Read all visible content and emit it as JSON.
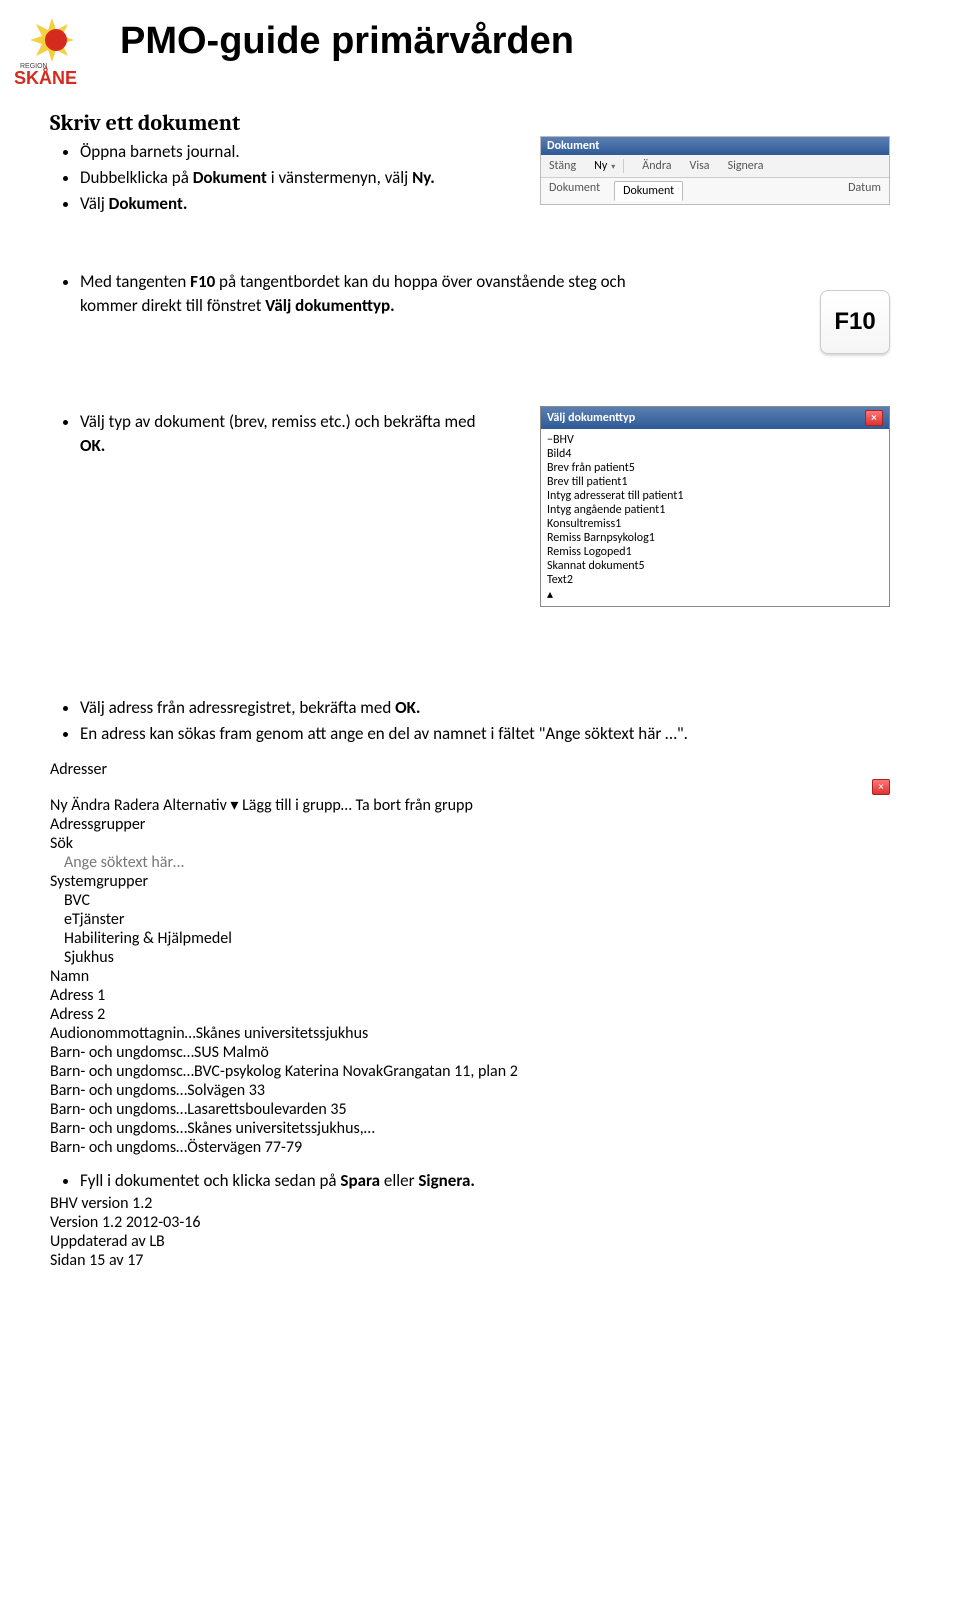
{
  "header": {
    "logo_text_top": "REGION",
    "logo_text_main": "SKÅNE",
    "title": "PMO-guide primärvården"
  },
  "section_title": "Skriv ett dokument",
  "block1": {
    "b1": "Öppna barnets journal.",
    "b2_pre": "Dubbelklicka på ",
    "b2_bold": "Dokument",
    "b2_post": " i vänstermenyn, välj ",
    "b2_bold2": "Ny.",
    "b3_pre": "Välj ",
    "b3_bold": "Dokument."
  },
  "toolbar": {
    "title": "Dokument",
    "stang": "Stäng",
    "ny": "Ny",
    "andra": "Ändra",
    "visa": "Visa",
    "signera": "Signera",
    "tab1": "Dokument",
    "tab2": "Dokument",
    "datum": "Datum"
  },
  "block2": {
    "b1_pre": "Med tangenten ",
    "b1_bold1": "F10",
    "b1_mid": " på tangentbordet kan du hoppa över ovanstående steg och kommer direkt till fönstret ",
    "b1_bold2": "Välj dokumenttyp.",
    "key_label": "F10"
  },
  "block3": {
    "b1_pre": "Välj typ av dokument (brev, remiss etc.) och bekräfta med ",
    "b1_bold": "OK."
  },
  "dokumenttyp": {
    "title": "Välj dokumenttyp",
    "root": "BHV",
    "rows": [
      {
        "label": "Bild",
        "n": "4"
      },
      {
        "label": "Brev från patient",
        "n": "5"
      },
      {
        "label": "Brev till patient",
        "n": "1"
      },
      {
        "label": "Intyg adresserat till patient",
        "n": "1"
      },
      {
        "label": "Intyg angående patient",
        "n": "1"
      },
      {
        "label": "Konsultremiss",
        "n": "1"
      },
      {
        "label": "Remiss Barnpsykolog",
        "n": "1"
      },
      {
        "label": "Remiss Logoped",
        "n": "1"
      },
      {
        "label": "Skannat dokument",
        "n": "5"
      },
      {
        "label": "Text",
        "n": "2"
      }
    ]
  },
  "block4": {
    "b1_pre": "Välj adress från adressregistret, bekräfta med ",
    "b1_bold": "OK.",
    "b2": "En adress kan sökas fram genom att ange en del av namnet i fältet \"Ange söktext här …\"."
  },
  "adresser": {
    "title": "Adresser",
    "tb": {
      "ny": "Ny",
      "andra": "Ändra",
      "radera": "Radera",
      "alternativ": "Alternativ",
      "lagg": "Lägg till i grupp…",
      "tabort": "Ta bort från grupp"
    },
    "left_hdr": "Adressgrupper",
    "left_items": {
      "sok": "Sök",
      "sok_hint": "Ange söktext här…",
      "systemgrupper": "Systemgrupper",
      "bvc": "BVC",
      "etjanster": "eTjänster",
      "hab": "Habilitering & Hjälpmedel",
      "sjukhus": "Sjukhus"
    },
    "right_hdr": {
      "namn": "Namn",
      "a1": "Adress 1",
      "a2": "Adress 2"
    },
    "rows": [
      {
        "n": "Audionommottagnin…",
        "a1": "Skånes universitetssjukhus",
        "a2": ""
      },
      {
        "n": "Barn- och ungdomsc…",
        "a1": "SUS Malmö",
        "a2": ""
      },
      {
        "n": "Barn- och ungdomsc…",
        "a1": "BVC-psykolog Katerina Novak",
        "a2": "Grangatan 11, plan 2"
      },
      {
        "n": "Barn- och ungdoms…",
        "a1": "Solvägen 33",
        "a2": ""
      },
      {
        "n": "Barn- och ungdoms…",
        "a1": "Lasarettsboulevarden 35",
        "a2": ""
      },
      {
        "n": "Barn- och ungdoms…",
        "a1": "Skånes universitetssjukhus,…",
        "a2": ""
      },
      {
        "n": "Barn- och ungdoms…",
        "a1": "Östervägen 77-79",
        "a2": ""
      }
    ]
  },
  "block6": {
    "b1_pre": "Fyll i dokumentet och klicka sedan på ",
    "b1_bold1": "Spara",
    "b1_mid": " eller ",
    "b1_bold2": "Signera."
  },
  "footer": {
    "l1": "BHV version 1.2",
    "l2": "Version 1.2 2012-03-16",
    "l3": "Uppdaterad av LB",
    "right": "Sidan 15 av 17"
  }
}
